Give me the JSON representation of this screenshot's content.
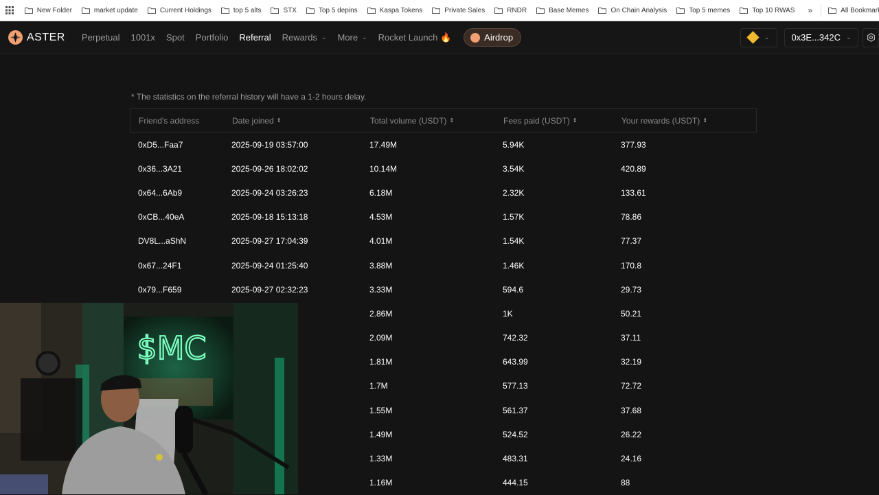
{
  "bookmarks": {
    "items": [
      {
        "label": "New Folder"
      },
      {
        "label": "market update"
      },
      {
        "label": "Current Holdings"
      },
      {
        "label": "top 5 alts"
      },
      {
        "label": "STX"
      },
      {
        "label": "Top 5 depins"
      },
      {
        "label": "Kaspa Tokens"
      },
      {
        "label": "Private Sales"
      },
      {
        "label": "RNDR"
      },
      {
        "label": "Base Memes"
      },
      {
        "label": "On Chain Analysis"
      },
      {
        "label": "Top 5 memes"
      },
      {
        "label": "Top 10 RWAS"
      }
    ],
    "more": "»",
    "all_label": "All Bookmarks"
  },
  "nav": {
    "brand": "ASTER",
    "links": [
      {
        "label": "Perpetual"
      },
      {
        "label": "1001x"
      },
      {
        "label": "Spot"
      },
      {
        "label": "Portfolio"
      },
      {
        "label": "Referral",
        "active": true
      },
      {
        "label": "Rewards",
        "dropdown": true
      },
      {
        "label": "More",
        "dropdown": true
      },
      {
        "label": "Rocket Launch 🔥"
      }
    ],
    "airdrop_label": "Airdrop",
    "wallet": "0x3E...342C",
    "chev": "⌄"
  },
  "referral": {
    "note": "* The statistics on the referral history will have a 1-2 hours delay.",
    "columns": [
      "Friend's address",
      "Date joined",
      "Total volume (USDT)",
      "Fees paid (USDT)",
      "Your rewards (USDT)"
    ],
    "sort_icon": "⇕",
    "rows": [
      [
        "0xD5...Faa7",
        "2025-09-19 03:57:00",
        "17.49M",
        "5.94K",
        "377.93"
      ],
      [
        "0x36...3A21",
        "2025-09-26 18:02:02",
        "10.14M",
        "3.54K",
        "420.89"
      ],
      [
        "0x64...6Ab9",
        "2025-09-24 03:26:23",
        "6.18M",
        "2.32K",
        "133.61"
      ],
      [
        "0xCB...40eA",
        "2025-09-18 15:13:18",
        "4.53M",
        "1.57K",
        "78.86"
      ],
      [
        "DV8L...aShN",
        "2025-09-27 17:04:39",
        "4.01M",
        "1.54K",
        "77.37"
      ],
      [
        "0x67...24F1",
        "2025-09-24 01:25:40",
        "3.88M",
        "1.46K",
        "170.8"
      ],
      [
        "0x79...F659",
        "2025-09-27 02:32:23",
        "3.33M",
        "594.6",
        "29.73"
      ],
      [
        "",
        ":19:49",
        "2.86M",
        "1K",
        "50.21"
      ],
      [
        "",
        ":35:22",
        "2.09M",
        "742.32",
        "37.11"
      ],
      [
        "",
        ":35:55",
        "1.81M",
        "643.99",
        "32.19"
      ],
      [
        "",
        ":36:09",
        "1.7M",
        "577.13",
        "72.72"
      ],
      [
        "",
        ":10:23",
        "1.55M",
        "561.37",
        "37.68"
      ],
      [
        "",
        ":37:37",
        "1.49M",
        "524.52",
        "26.22"
      ],
      [
        "",
        ":10:36",
        "1.33M",
        "483.31",
        "24.16"
      ],
      [
        "",
        ":45:13",
        "1.16M",
        "444.15",
        "88"
      ]
    ]
  },
  "webcam": {
    "sign_text": "$MC"
  },
  "colors": {
    "accent": "#f0a072",
    "background": "#141414",
    "text": "#ffffff",
    "muted": "#9a9a9a"
  }
}
